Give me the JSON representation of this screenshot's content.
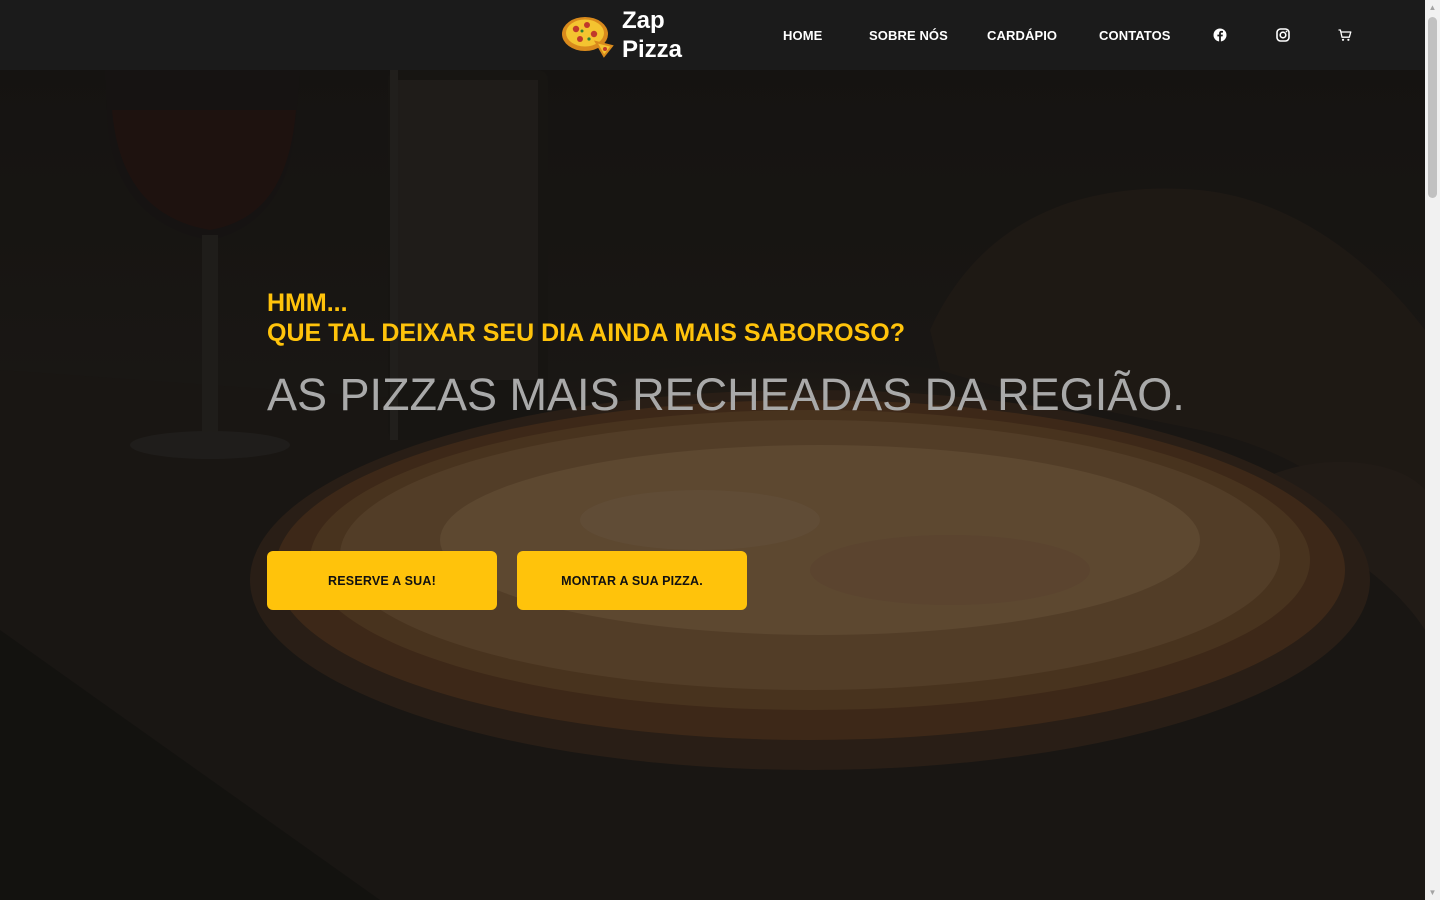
{
  "header": {
    "logo_icon": "pizza-logo-icon",
    "brand_line1": "Zap",
    "brand_line2": "Pizza",
    "nav": [
      {
        "label": "HOME"
      },
      {
        "label": "SOBRE NÓS"
      },
      {
        "label": "CARDÁPIO"
      },
      {
        "label": "CONTATOS"
      }
    ],
    "icons": [
      "facebook-icon",
      "instagram-icon",
      "cart-icon"
    ]
  },
  "hero": {
    "eyebrow_line1": "HMM...",
    "eyebrow_line2": "QUE TAL DEIXAR SEU DIA AINDA MAIS SABOROSO?",
    "headline": "AS PIZZAS MAIS RECHEADAS DA REGIÃO.",
    "buttons": {
      "reserve": "RESERVE A SUA!",
      "build": "MONTAR A SUA PIZZA."
    },
    "background": "dark photo of a pizza with a wine glass and bottle"
  },
  "colors": {
    "accent": "#ffc30b",
    "header_bg": "#1b1b1b",
    "headline": "#a9a9a9"
  }
}
